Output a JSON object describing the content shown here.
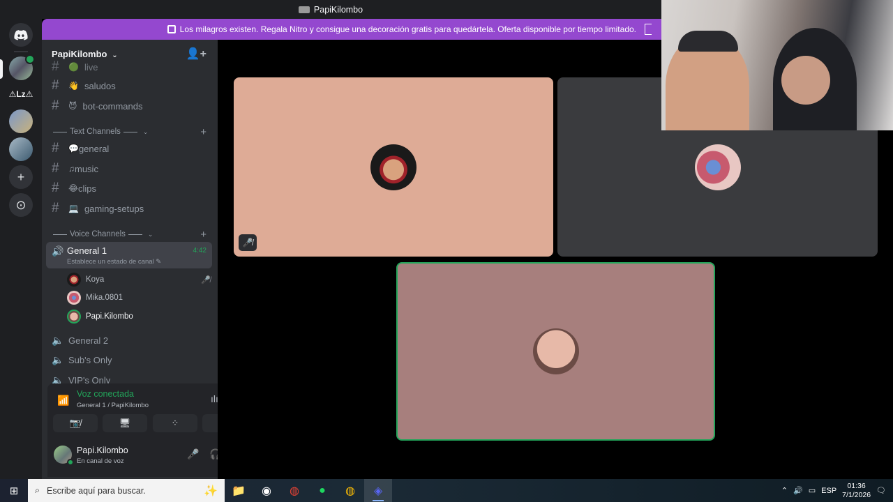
{
  "window": {
    "title": "PapiKilombo"
  },
  "rail": {
    "text_server": "⚠Lz⚠",
    "add": "+",
    "discover": "⊙"
  },
  "banner": {
    "text": "Los milagros existen. Regala Nitro y consigue una decoración gratis para quedártela. Oferta disponible por tiempo limitado."
  },
  "server": {
    "name": "PapiKilombo"
  },
  "channels_top": [
    {
      "emoji": "🟢",
      "label": "live"
    },
    {
      "emoji": "👋",
      "label": "saludos"
    },
    {
      "emoji": "😈",
      "label": "bot-commands"
    }
  ],
  "text_category": "Text Channels",
  "text_channels": [
    {
      "emoji": "💬",
      "label": "general"
    },
    {
      "emoji": "♫",
      "label": "music"
    },
    {
      "emoji": "😂",
      "label": "clips"
    },
    {
      "emoji": "💻",
      "label": "gaming-setups"
    }
  ],
  "voice_category": "Voice Channels",
  "active_voice": {
    "name": "General 1",
    "time": "4:42",
    "status": "Establece un estado de canal"
  },
  "voice_users": [
    {
      "name": "Koya",
      "muted": true
    },
    {
      "name": "Mika.0801",
      "muted": false
    },
    {
      "name": "Papi.Kilombo",
      "muted": false
    }
  ],
  "voice_channels": [
    {
      "label": "General 2"
    },
    {
      "label": "Sub's Only"
    },
    {
      "label": "VIP's Only"
    }
  ],
  "voice_panel": {
    "status": "Voz conectada",
    "location": "General 1 / PapiKilombo"
  },
  "user": {
    "name": "Papi.Kilombo",
    "status": "En canal de voz"
  },
  "taskbar": {
    "search_placeholder": "Escribe aquí para buscar.",
    "lang": "ESP",
    "time": "01:36",
    "date": "7/1/2026"
  },
  "colors": {
    "accent_green": "#23a55a",
    "banner_purple": "#9448cf",
    "tile1": "#deab96",
    "tile3": "#a77f7d"
  }
}
